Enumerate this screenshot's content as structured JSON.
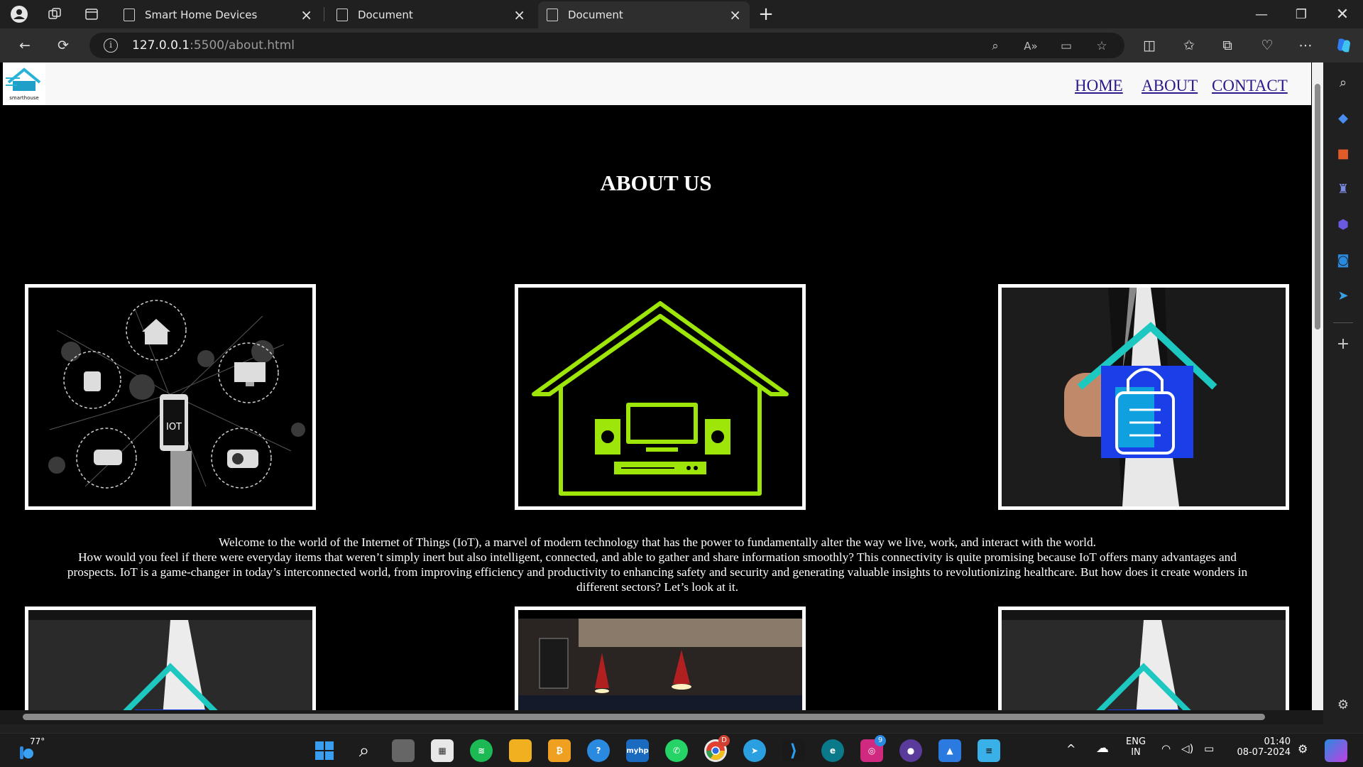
{
  "browser": {
    "tabs": [
      {
        "title": "Smart Home Devices",
        "active": false
      },
      {
        "title": "Document",
        "active": false
      },
      {
        "title": "Document",
        "active": true
      }
    ],
    "url_host": "127.0.0.1",
    "url_rest": ":5500/about.html"
  },
  "site": {
    "logo_text": "smarthouse",
    "nav": [
      "HOME",
      "ABOUT",
      "CONTACT"
    ],
    "heading": "ABOUT US",
    "iot_label": "IOT",
    "paragraph_lines": [
      "Welcome to the world of the Internet of Things (IoT), a marvel of modern technology that has the power to fundamentally alter the way we live, work, and interact with the world.",
      "How would you feel if there were everyday items that weren’t simply inert but also intelligent, connected, and able to gather and share information smoothly? This connectivity is quite promising because IoT offers many advantages and prospects. IoT is a game-changer in today’s interconnected world, from improving efficiency and productivity to enhancing safety and security and generating valuable insights to revolutionizing healthcare. But how does it create wonders in different sectors? Let’s look at it."
    ]
  },
  "taskbar": {
    "weather": "77°",
    "language": "ENG",
    "region": "IN",
    "time": "01:40",
    "date": "08-07-2024",
    "badges": {
      "chrome": "D",
      "instagram": "9"
    }
  },
  "colors": {
    "accent_green": "#9ee60a",
    "nav_link": "#2a1a8a"
  }
}
